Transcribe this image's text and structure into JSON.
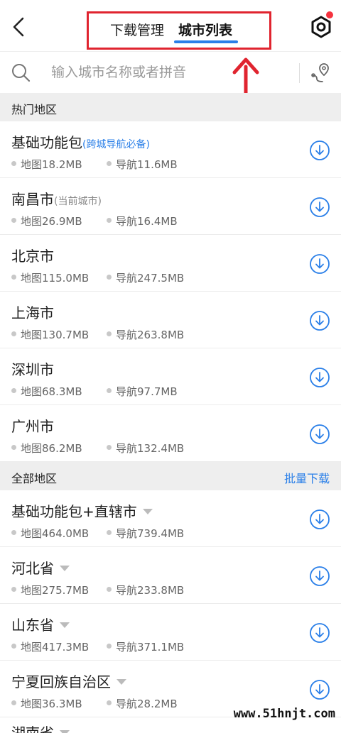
{
  "header": {
    "tabs": [
      {
        "label": "下载管理",
        "active": false
      },
      {
        "label": "城市列表",
        "active": true
      }
    ],
    "accent_color": "#2a7fe8",
    "highlight_color": "#e0242f"
  },
  "search": {
    "placeholder": "输入城市名称或者拼音"
  },
  "hot_section": {
    "label": "热门地区",
    "items": [
      {
        "name": "基础功能包",
        "tag": "(跨城导航必备)",
        "map": "地图18.2MB",
        "nav": "导航11.6MB"
      },
      {
        "name": "南昌市",
        "tag": "(当前城市)",
        "map": "地图26.9MB",
        "nav": "导航16.4MB"
      },
      {
        "name": "北京市",
        "map": "地图115.0MB",
        "nav": "导航247.5MB"
      },
      {
        "name": "上海市",
        "map": "地图130.7MB",
        "nav": "导航263.8MB"
      },
      {
        "name": "深圳市",
        "map": "地图68.3MB",
        "nav": "导航97.7MB"
      },
      {
        "name": "广州市",
        "map": "地图86.2MB",
        "nav": "导航132.4MB"
      }
    ]
  },
  "all_section": {
    "label": "全部地区",
    "action": "批量下载",
    "items": [
      {
        "name": "基础功能包+直辖市",
        "map": "地图464.0MB",
        "nav": "导航739.4MB"
      },
      {
        "name": "河北省",
        "map": "地图275.7MB",
        "nav": "导航233.8MB"
      },
      {
        "name": "山东省",
        "map": "地图417.3MB",
        "nav": "导航371.1MB"
      },
      {
        "name": "宁夏回族自治区",
        "map": "地图36.3MB",
        "nav": "导航28.2MB"
      },
      {
        "name": "湖南省"
      }
    ]
  },
  "watermark": "www.51hnjt.com"
}
